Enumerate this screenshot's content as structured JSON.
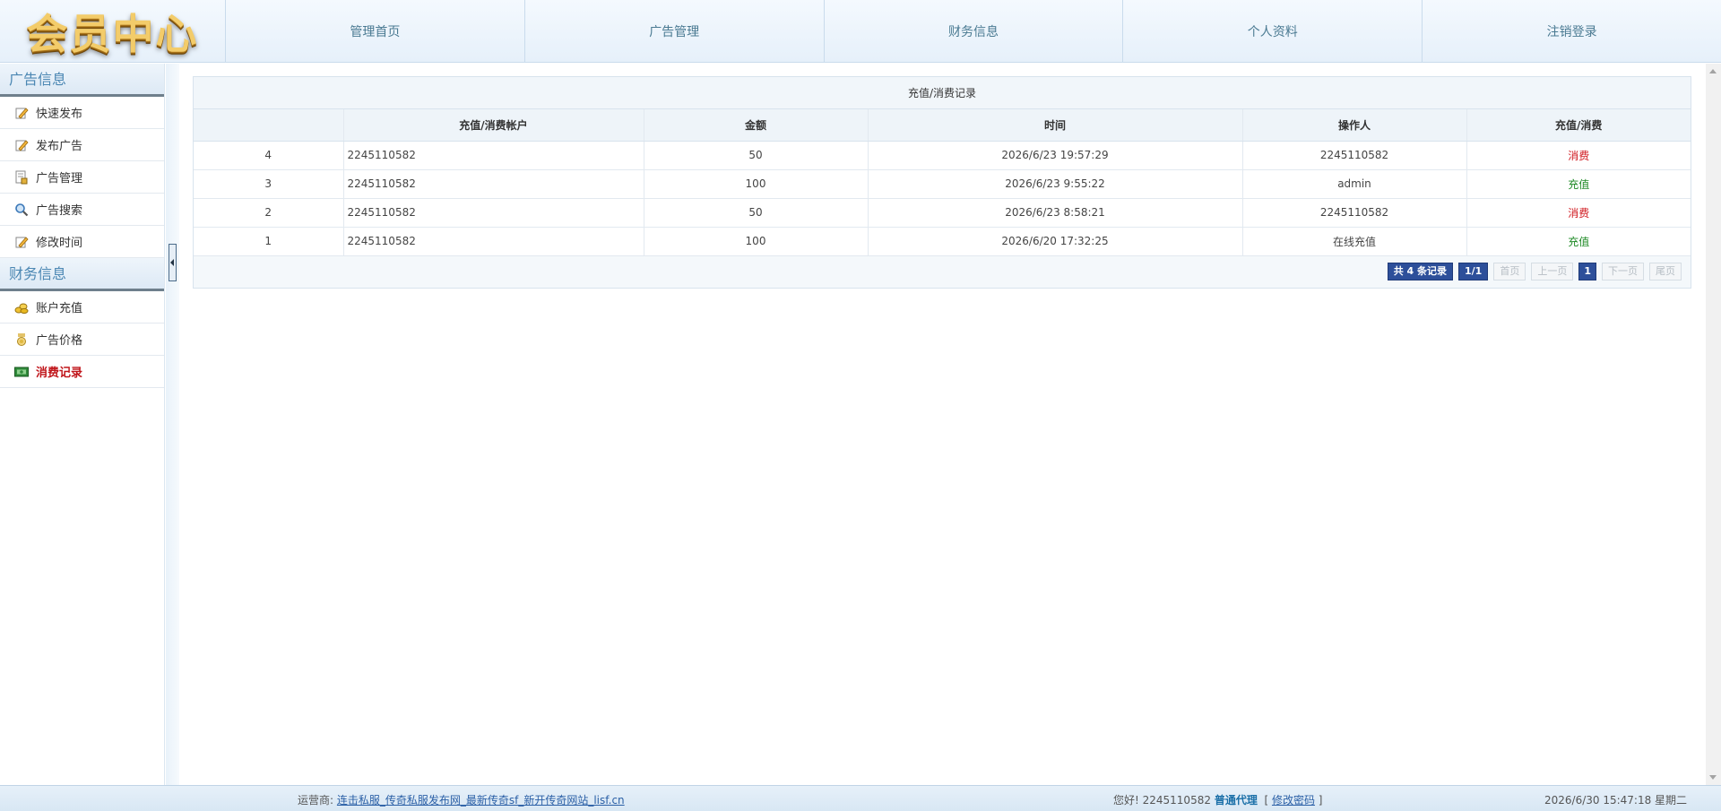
{
  "header": {
    "logo": "会员中心",
    "nav": [
      "管理首页",
      "广告管理",
      "财务信息",
      "个人资料",
      "注销登录"
    ]
  },
  "sidebar": {
    "sections": [
      {
        "title": "广告信息",
        "items": [
          {
            "label": "快速发布",
            "icon": "edit-icon"
          },
          {
            "label": "发布广告",
            "icon": "edit-icon"
          },
          {
            "label": "广告管理",
            "icon": "document-lock-icon"
          },
          {
            "label": "广告搜索",
            "icon": "search-icon"
          },
          {
            "label": "修改时间",
            "icon": "edit-icon"
          }
        ]
      },
      {
        "title": "财务信息",
        "items": [
          {
            "label": "账户充值",
            "icon": "coins-icon"
          },
          {
            "label": "广告价格",
            "icon": "medal-icon"
          },
          {
            "label": "消费记录",
            "icon": "banknote-icon",
            "active": true
          }
        ]
      }
    ]
  },
  "panel": {
    "title": "充值/消费记录",
    "columns": [
      "",
      "充值/消费帐户",
      "金额",
      "时间",
      "操作人",
      "充值/消费"
    ],
    "rows": [
      {
        "id": "4",
        "account": "2245110582",
        "amount": "50",
        "time": "2026/6/23 19:57:29",
        "operator": "2245110582",
        "type": "消费"
      },
      {
        "id": "3",
        "account": "2245110582",
        "amount": "100",
        "time": "2026/6/23 9:55:22",
        "operator": "admin",
        "type": "充值"
      },
      {
        "id": "2",
        "account": "2245110582",
        "amount": "50",
        "time": "2026/6/23 8:58:21",
        "operator": "2245110582",
        "type": "消费"
      },
      {
        "id": "1",
        "account": "2245110582",
        "amount": "100",
        "time": "2026/6/20 17:32:25",
        "operator": "在线充值",
        "type": "充值"
      }
    ],
    "pager": {
      "total": "共 4 条记录",
      "pages": "1/1",
      "first": "首页",
      "prev": "上一页",
      "current": "1",
      "next": "下一页",
      "last": "尾页"
    }
  },
  "footer": {
    "operator_label": "运营商:",
    "operator_link": "连击私服_传奇私服发布网_最新传奇sf_新开传奇网站_lisf.cn",
    "greeting": "您好! 2245110582",
    "role": "普通代理",
    "change_pwd": "修改密码",
    "datetime": "2026/6/30 15:47:18 星期二"
  },
  "colors": {
    "consume": "#d0191f",
    "recharge": "#1f8a26",
    "pager_active": "#2d4f9a"
  }
}
